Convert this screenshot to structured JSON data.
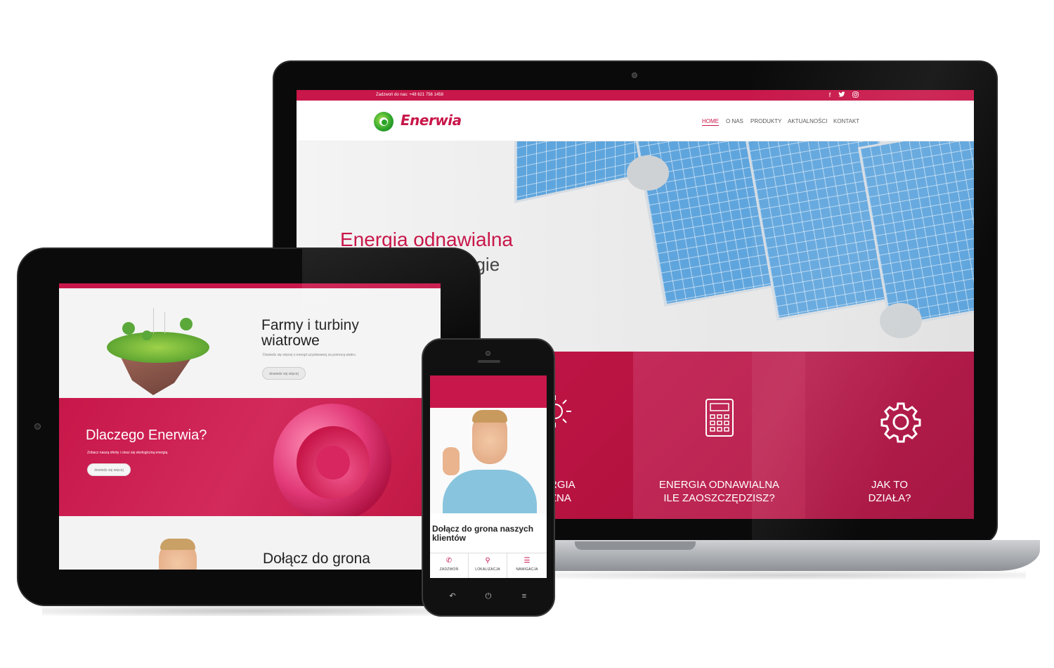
{
  "colors": {
    "brand": "#c8174a",
    "brand_logo_green": "#2aa32b",
    "device_black": "#0b0b0b"
  },
  "laptop": {
    "topbar": {
      "phone_text": "Zadzwoń do nas: +48 621 756 1458",
      "social_icons": [
        "facebook-icon",
        "twitter-icon",
        "instagram-icon"
      ]
    },
    "logo": {
      "text": "Enerwia"
    },
    "nav": [
      {
        "label": "HOME",
        "active": true
      },
      {
        "label": "O NAS",
        "active": false
      },
      {
        "label": "PRODUKTY",
        "active": false
      },
      {
        "label": "AKTUALNOŚCI",
        "active": false
      },
      {
        "label": "KONTAKT",
        "active": false
      }
    ],
    "hero": {
      "title": "Energia odnawialna",
      "subtitle_visible": "ogie"
    },
    "features": [
      {
        "icon": "sun-icon",
        "line1": "ERGIA",
        "line2": "CZNA"
      },
      {
        "icon": "calculator-icon",
        "line1": "ENERGIA ODNAWIALNA",
        "line2": "ILE ZAOSZCZĘDZISZ?"
      },
      {
        "icon": "gear-icon",
        "line1": "JAK TO",
        "line2": "DZIAŁA?"
      }
    ]
  },
  "tablet": {
    "section1": {
      "title_line1": "Farmy i turbiny",
      "title_line2": "wiatrowe",
      "small": "Dowiedz się więcej o energii uzyskiwanej za pomocą wiatru",
      "button": "dowiedz się więcej"
    },
    "section2": {
      "title": "Dlaczego Enerwia?",
      "small": "Zobacz naszą ofertę i ciesz się ekologiczną energią",
      "button": "dowiedz się więcej"
    },
    "section3": {
      "title": "Dołącz do grona"
    }
  },
  "phone": {
    "title": "Dołącz do grona naszych klientów",
    "bottom_buttons": [
      {
        "icon": "phone-icon",
        "label": "ZADZWOŃ"
      },
      {
        "icon": "location-pin-icon",
        "label": "LOKALIZACJA"
      },
      {
        "icon": "menu-icon",
        "label": "NAWIGACJA"
      }
    ],
    "system_nav": [
      "back-icon",
      "power-icon",
      "menu-icon"
    ]
  }
}
